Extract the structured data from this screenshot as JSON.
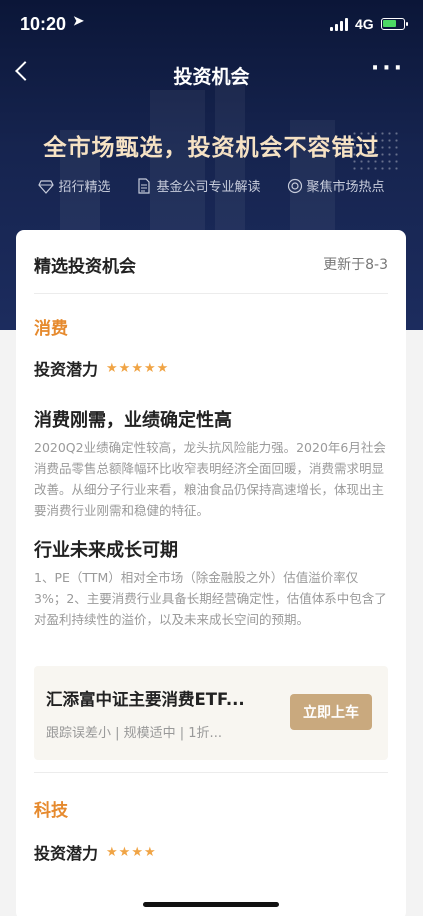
{
  "status_bar": {
    "time": "10:20",
    "network": "4G"
  },
  "nav": {
    "title": "投资机会"
  },
  "hero": {
    "slogan": "全市场甄选，投资机会不容错过",
    "features": [
      {
        "icon": "diamond-icon",
        "label": "招行精选"
      },
      {
        "icon": "document-icon",
        "label": "基金公司专业解读"
      },
      {
        "icon": "target-icon",
        "label": "聚焦市场热点"
      }
    ]
  },
  "card": {
    "header": "精选投资机会",
    "updated": "更新于8-3",
    "categories": [
      {
        "name": "消费",
        "potential_label": "投资潜力",
        "stars": 5,
        "sections": [
          {
            "title": "消费刚需，业绩确定性高",
            "text": "2020Q2业绩确定性较高，龙头抗风险能力强。2020年6月社会消费品零售总额降幅环比收窄表明经济全面回暖，消费需求明显改善。从细分子行业来看，粮油食品仍保持高速增长，体现出主要消费行业刚需和稳健的特征。"
          },
          {
            "title": "行业未来成长可期",
            "text": "1、PE（TTM）相对全市场（除金融股之外）估值溢价率仅3%；2、主要消费行业具备长期经营确定性，估值体系中包含了对盈利持续性的溢价，以及未来成长空间的预期。"
          }
        ],
        "fund": {
          "name": "汇添富中证主要消费ETF...",
          "tags": "跟踪误差小 | 规模适中 | 1折...",
          "button": "立即上车"
        }
      },
      {
        "name": "科技",
        "potential_label": "投资潜力",
        "stars": 4
      }
    ]
  },
  "colors": {
    "accent": "#e68a2e",
    "star": "#f0a445",
    "button": "#c9a97e",
    "hero": "#16244f"
  }
}
